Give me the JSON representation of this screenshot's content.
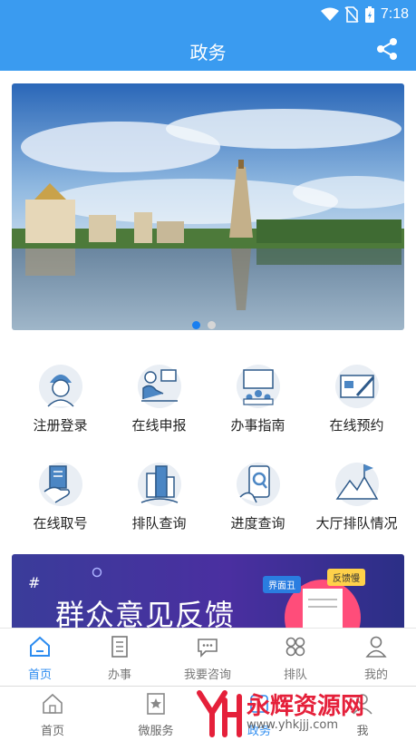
{
  "status": {
    "time": "7:18"
  },
  "header": {
    "title": "政务"
  },
  "banner": {
    "slide_count": 2,
    "active_slide": 1
  },
  "services": [
    {
      "label": "注册登录",
      "icon": "worker-helmet-icon"
    },
    {
      "label": "在线申报",
      "icon": "computer-desk-icon"
    },
    {
      "label": "办事指南",
      "icon": "presentation-board-icon"
    },
    {
      "label": "在线预约",
      "icon": "calendar-pen-icon"
    },
    {
      "label": "在线取号",
      "icon": "ticket-hand-icon"
    },
    {
      "label": "排队查询",
      "icon": "city-buildings-icon"
    },
    {
      "label": "进度查询",
      "icon": "phone-search-icon"
    },
    {
      "label": "大厅排队情况",
      "icon": "mountain-flag-icon"
    }
  ],
  "feedback_banner": {
    "title": "群众意见反馈",
    "tag1": "界面丑",
    "tag2": "反馈慢",
    "hash": "#"
  },
  "tabbar": [
    {
      "label": "首页",
      "icon": "home-icon",
      "active": true
    },
    {
      "label": "办事",
      "icon": "checklist-icon",
      "active": false
    },
    {
      "label": "我要咨询",
      "icon": "chat-icon",
      "active": false
    },
    {
      "label": "排队",
      "icon": "grid-icon",
      "active": false
    },
    {
      "label": "我的",
      "icon": "user-icon",
      "active": false
    }
  ],
  "bottom_nav": [
    {
      "label": "首页",
      "icon": "home-outline-icon"
    },
    {
      "label": "微服务",
      "icon": "star-bookmark-icon"
    },
    {
      "label": "政务",
      "icon": "government-icon"
    },
    {
      "label": "我",
      "icon": "person-icon"
    }
  ],
  "watermark": {
    "text": "永辉资源网",
    "url": "www.yhkjjj.com"
  },
  "colors": {
    "primary": "#3a9bf0",
    "active_tab": "#2d8cf0",
    "watermark": "#e5203a"
  }
}
